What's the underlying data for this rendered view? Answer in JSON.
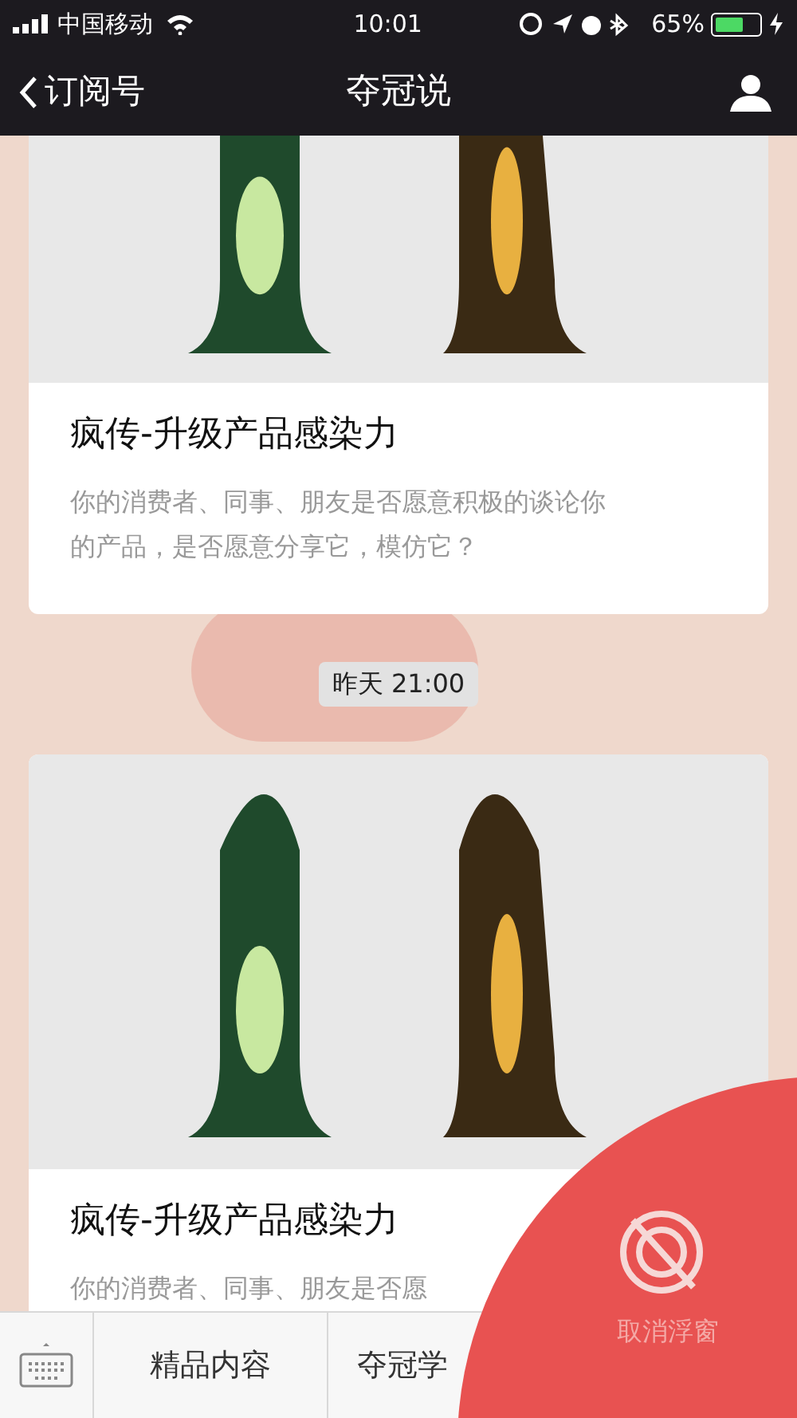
{
  "status_bar": {
    "carrier": "中国移动",
    "time": "10:01",
    "battery_text": "65%",
    "battery": {
      "level": 0.65
    }
  },
  "nav": {
    "back_label": "订阅号",
    "title": "夺冠说"
  },
  "messages": [
    {
      "kind": "article",
      "title": "疯传-升级产品感染力",
      "description": [
        "你的消费者、同事、朋友是否愿意积极的谈论你",
        "的产品，是否愿意分享它，模仿它？"
      ]
    },
    {
      "kind": "timestamp",
      "text": "昨天 21:00"
    },
    {
      "kind": "article",
      "title": "疯传-升级产品感染力",
      "description": [
        "你的消费者、同事、朋友是否愿"
      ]
    }
  ],
  "bottom_menu": [
    "精品内容",
    "夺冠学"
  ],
  "floating_window": {
    "label": "取消浮窗"
  }
}
